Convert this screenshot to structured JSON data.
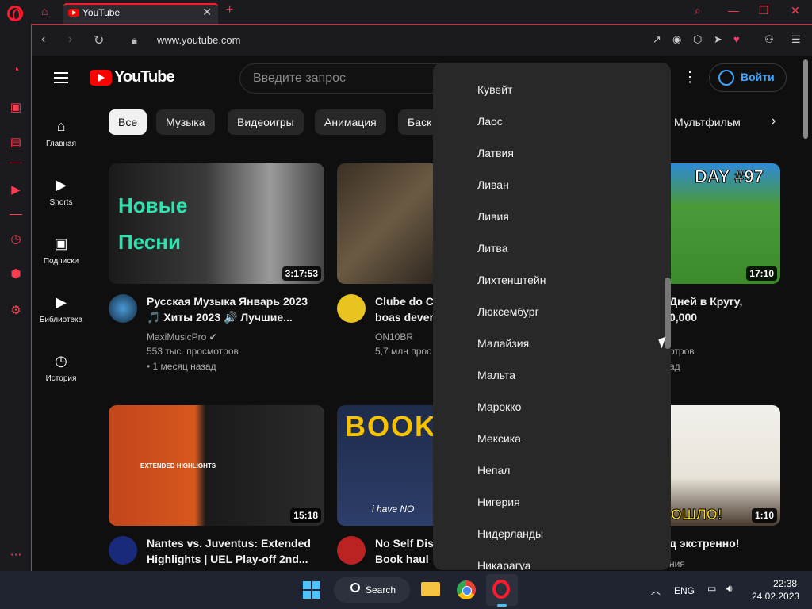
{
  "browser": {
    "tab_title": "YouTube",
    "url": "www.youtube.com"
  },
  "youtube": {
    "logo_text": "YouTube",
    "search_placeholder": "Введите запрос",
    "signin_label": "Войти",
    "guide": [
      {
        "label": "Главная",
        "icon": "home-icon"
      },
      {
        "label": "Shorts",
        "icon": "shorts-icon"
      },
      {
        "label": "Подписки",
        "icon": "subscriptions-icon"
      },
      {
        "label": "Библиотека",
        "icon": "library-icon"
      },
      {
        "label": "История",
        "icon": "history-icon"
      }
    ],
    "chips": [
      "Все",
      "Музыка",
      "Видеоигры",
      "Анимация",
      "Баск",
      "Мультфильм"
    ],
    "videos": [
      {
        "thumb_text": "Новые Песни",
        "duration": "3:17:53",
        "title_line1": "Русская Музыка Январь 2023",
        "title_line2": "🎵 Хиты 2023 🔊 Лучшие...",
        "channel": "MaxiMusicPro ✔",
        "views": "553 тыс. просмотров",
        "age": "• 1 месяц назад"
      },
      {
        "title_line1": "Clube do Ch",
        "title_line2": "boas devem",
        "channel": "ON10BR",
        "views": "5,7 млн прос"
      },
      {
        "thumb_text": "DAY #97",
        "duration": "17:10",
        "title_line1": "Дней в Кругу,",
        "title_line2": "0,000",
        "views": "отров",
        "age": "ад"
      },
      {
        "thumb_text": "EXTENDED HIGHLIGHTS",
        "duration": "15:18",
        "title_line1": "Nantes vs. Juventus: Extended",
        "title_line2": "Highlights | UEL Play-off 2nd..."
      },
      {
        "thumb_text": "BOOK",
        "thumb_sub": "i have NO",
        "title_line1": "No Self Disc",
        "title_line2": "Book haul"
      },
      {
        "thumb_text": "ЗОШЛО!",
        "duration": "1:10",
        "title_line1": "д экстренно!",
        "meta": "ния"
      }
    ]
  },
  "country_menu": {
    "items": [
      "Кувейт",
      "Лаос",
      "Латвия",
      "Ливан",
      "Ливия",
      "Литва",
      "Лихтенштейн",
      "Люксембург",
      "Малайзия",
      "Мальта",
      "Марокко",
      "Мексика",
      "Непал",
      "Нигерия",
      "Нидерланды",
      "Никарагуа"
    ]
  },
  "taskbar": {
    "search_label": "Search",
    "lang": "ENG",
    "time": "22:38",
    "date": "24.02.2023"
  },
  "colors": {
    "opera_red": "#ff1b2d",
    "yt_red": "#ff0000",
    "link_blue": "#3ea6ff"
  }
}
